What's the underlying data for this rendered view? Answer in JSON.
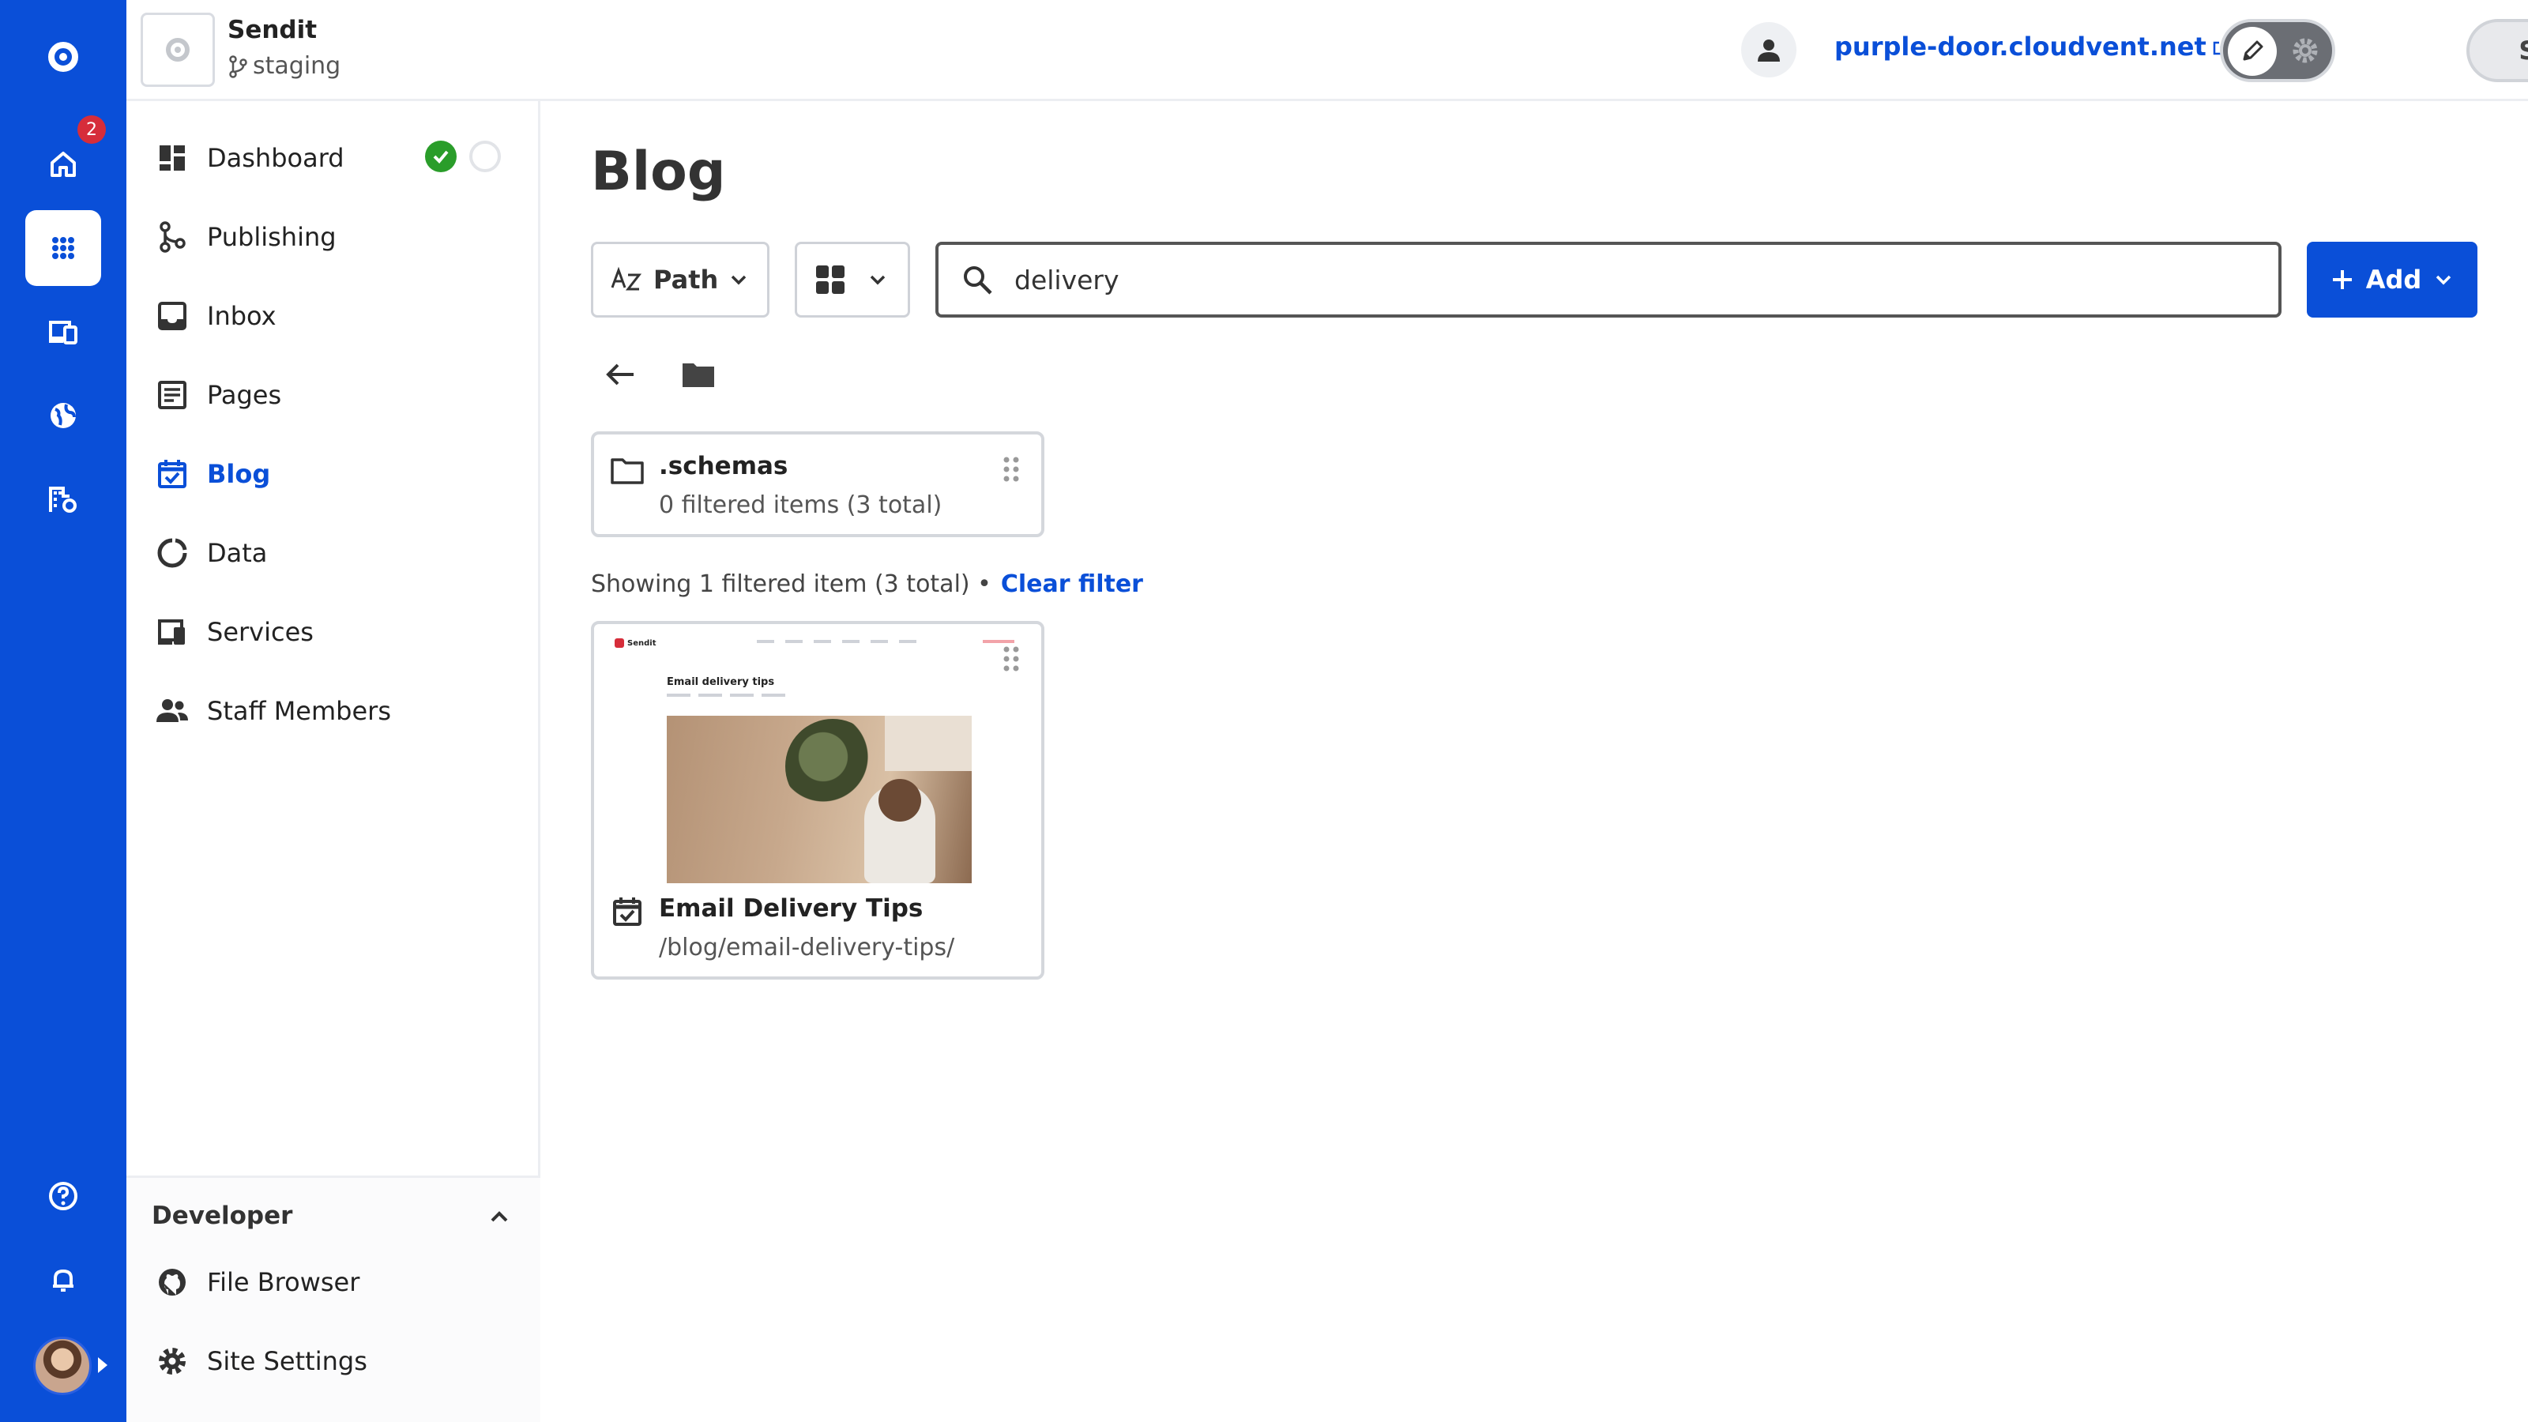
{
  "app": {
    "site_name": "Sendit",
    "branch": "staging",
    "site_url": "purple-door.cloudvent.net",
    "save_label": "Save"
  },
  "rail": {
    "home_badge": "2"
  },
  "sidebar": {
    "items": [
      {
        "label": "Dashboard",
        "icon": "dashboard-icon"
      },
      {
        "label": "Publishing",
        "icon": "git-branch-icon"
      },
      {
        "label": "Inbox",
        "icon": "inbox-icon"
      },
      {
        "label": "Pages",
        "icon": "pages-icon"
      },
      {
        "label": "Blog",
        "icon": "calendar-check-icon",
        "active": true
      },
      {
        "label": "Data",
        "icon": "data-icon"
      },
      {
        "label": "Services",
        "icon": "services-icon"
      },
      {
        "label": "Staff Members",
        "icon": "people-icon"
      }
    ],
    "developer": {
      "title": "Developer",
      "items": [
        {
          "label": "File Browser",
          "icon": "github-icon"
        },
        {
          "label": "Site Settings",
          "icon": "gear-icon"
        }
      ]
    }
  },
  "main": {
    "title": "Blog",
    "sort_label": "Path",
    "search_value": "delivery",
    "add_label": "Add",
    "folder_card": {
      "title": ".schemas",
      "subtitle": "0 filtered items (3 total)"
    },
    "showing_text": "Showing 1 filtered item (3 total) •",
    "clear_filter": "Clear filter",
    "post_card": {
      "title": "Email Delivery Tips",
      "path": "/blog/email-delivery-tips/",
      "preview": {
        "brand": "Sendit",
        "heading": "Email delivery tips"
      }
    }
  },
  "colors": {
    "accent": "#0a4fd8",
    "badge": "#d62d3a",
    "success": "#2a9d2a"
  }
}
